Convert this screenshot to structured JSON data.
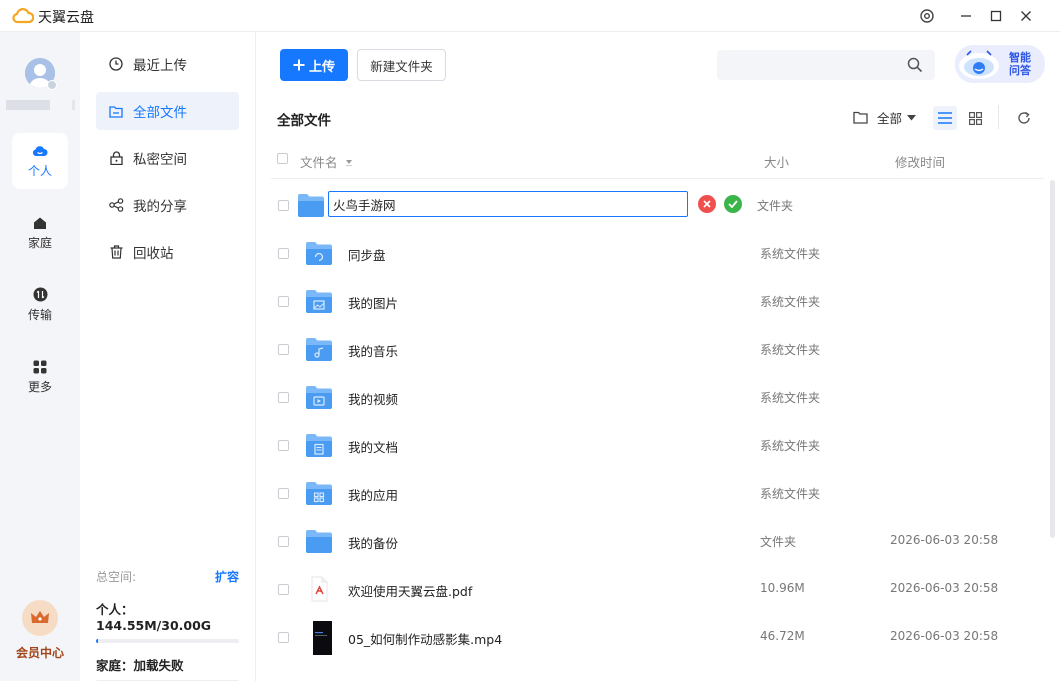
{
  "titlebar": {
    "app_title": "天翼云盘"
  },
  "rail": {
    "items": [
      {
        "label": "个人",
        "icon": "cloud-icon"
      },
      {
        "label": "家庭",
        "icon": "home-icon"
      },
      {
        "label": "传输",
        "icon": "transfer-icon"
      },
      {
        "label": "更多",
        "icon": "apps-icon"
      }
    ],
    "vip_label": "会员中心"
  },
  "nav": {
    "items": [
      {
        "label": "最近上传",
        "icon": "clock-icon"
      },
      {
        "label": "全部文件",
        "icon": "folder-icon"
      },
      {
        "label": "私密空间",
        "icon": "lock-icon"
      },
      {
        "label": "我的分享",
        "icon": "share-icon"
      },
      {
        "label": "回收站",
        "icon": "trash-icon"
      }
    ],
    "storage": {
      "title": "总空间:",
      "expand_label": "扩容",
      "personal": "个人：144.55M/30.00G",
      "personal_usage": 0.005,
      "family": "家庭：加载失败"
    }
  },
  "toolbar": {
    "upload_label": "上传",
    "new_folder_label": "新建文件夹",
    "search_placeholder": "",
    "ai_label_line1": "智能",
    "ai_label_line2": "问答"
  },
  "breadcrumb": "全部文件",
  "filter_label": "全部",
  "columns": {
    "name": "文件名",
    "size": "大小",
    "modified": "修改时间"
  },
  "rename": {
    "value": "火鸟手游网",
    "type": "文件夹"
  },
  "files": [
    {
      "name": "同步盘",
      "size": "系统文件夹",
      "modified": "",
      "kind": "sync"
    },
    {
      "name": "我的图片",
      "size": "系统文件夹",
      "modified": "",
      "kind": "image"
    },
    {
      "name": "我的音乐",
      "size": "系统文件夹",
      "modified": "",
      "kind": "music"
    },
    {
      "name": "我的视频",
      "size": "系统文件夹",
      "modified": "",
      "kind": "video"
    },
    {
      "name": "我的文档",
      "size": "系统文件夹",
      "modified": "",
      "kind": "doc"
    },
    {
      "name": "我的应用",
      "size": "系统文件夹",
      "modified": "",
      "kind": "app"
    },
    {
      "name": "我的备份",
      "size": "文件夹",
      "modified": "2026-06-03 20:58",
      "kind": "folder"
    },
    {
      "name": "欢迎使用天翼云盘.pdf",
      "size": "10.96M",
      "modified": "2026-06-03 20:58",
      "kind": "pdf"
    },
    {
      "name": "05_如何制作动感影集.mp4",
      "size": "46.72M",
      "modified": "2026-06-03 20:58",
      "kind": "mp4"
    }
  ],
  "colors": {
    "accent": "#1677ff",
    "folder": "#5aa8f5",
    "pdf": "#e0473a",
    "vip": "#a0461a"
  }
}
